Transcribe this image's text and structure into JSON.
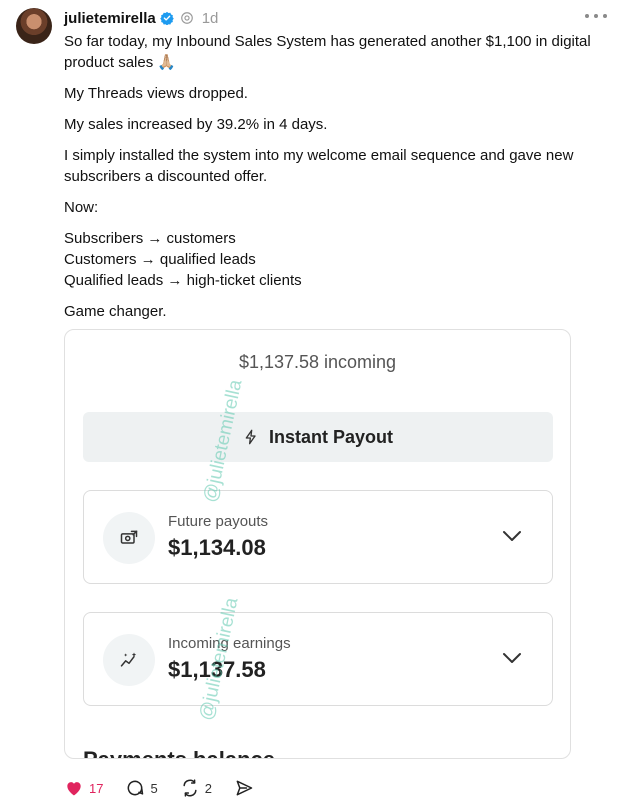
{
  "post": {
    "username": "julietemirella",
    "time": "1d",
    "verified": true,
    "paragraphs": [
      [
        "So far today, my Inbound Sales System has generated another $1,100 in digital product sales 🙏🏼"
      ],
      [
        "My Threads views dropped."
      ],
      [
        "My sales increased by 39.2% in 4 days."
      ],
      [
        "I simply installed the system into my welcome email sequence and gave new subscribers a discounted offer."
      ],
      [
        "Now:"
      ],
      [
        "Subscribers → customers",
        "Customers → qualified leads",
        "Qualified leads → high-ticket clients"
      ],
      [
        "Game changer."
      ]
    ]
  },
  "card": {
    "incoming": "$1,137.58 incoming",
    "payout_button": "Instant Payout",
    "future": {
      "label": "Future payouts",
      "value": "$1,134.08"
    },
    "earnings": {
      "label": "Incoming earnings",
      "value": "$1,137.58"
    },
    "payments_heading": "Payments balance",
    "watermark": "@julietemirella"
  },
  "actions": {
    "likes": "17",
    "replies": "5",
    "reposts": "2",
    "liked": true
  },
  "colors": {
    "like": "#e0245e",
    "verified": "#1d9bf0",
    "watermark": "#5fc8af"
  }
}
